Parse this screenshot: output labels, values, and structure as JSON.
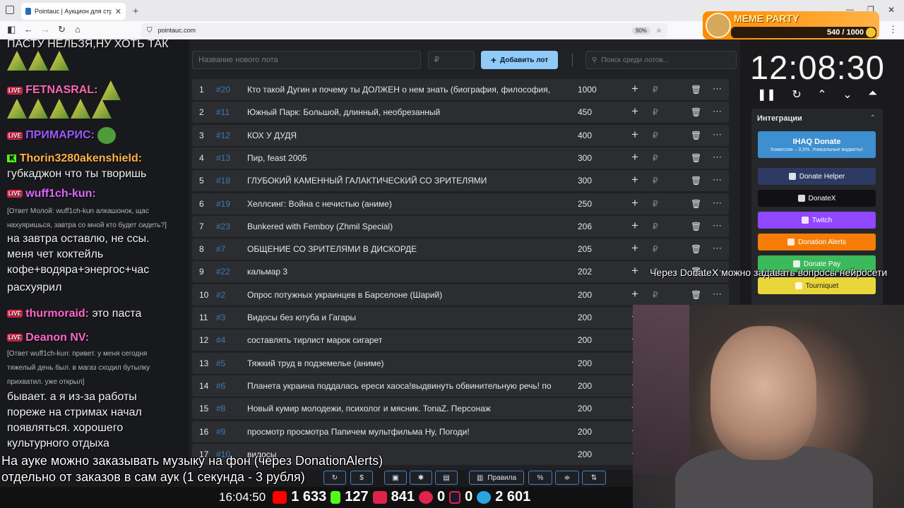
{
  "browser": {
    "tab_title": "Pointauc | Аукцион для стримера",
    "url": "pointauc.com",
    "zoom": "90%"
  },
  "chat": {
    "lines": [
      {
        "text": "ПАСТУ НЕЛЬЗЯ,НУ ХОТЬ ТАК"
      },
      {
        "nick": "FETNASRAL:",
        "nick_color": "#ff69b4"
      },
      {
        "nick": "ПРИМАРИС:",
        "nick_color": "#9b59ff"
      },
      {
        "nick": "Thorin3280akenshield:",
        "nick_color": "#ffb347",
        "text": "губкаджон что ты творишь"
      },
      {
        "nick": "wuff1ch-kun:",
        "nick_color": "#e066ff"
      },
      {
        "reply": "[Ответ Молой: wuff1ch-kun алкашонок, щас нахуяришься, завтра со мной кто будет сидеть?]"
      },
      {
        "text": "на завтра оставлю, не ссы. меня чет коктейль кофе+водяра+энергос+час расхуярил"
      },
      {
        "nick": "thurmoraid:",
        "nick_color": "#ff66cc",
        "text": "это паста"
      },
      {
        "nick": "Deanon NV:",
        "nick_color": "#ff66cc"
      },
      {
        "reply": "[Ответ wuff1ch-kun: привет. у меня сегодня тяжелый день был. в магаз сходил бутылку прихватил. уже открыл]"
      },
      {
        "text": "бывает. а я из-за работы пореже на стримах начал появляться. хорошего культурного отдыха"
      }
    ],
    "line_texts": {
      "l1": "ПАСТУ НЕЛЬЗЯ,НУ ХОТЬ ТАК",
      "l4b": "губкаджон что ты творишь",
      "l6a": "[Ответ Молой: wuff1ch-kun алкашонок, щас",
      "l6b": "нахуяришься, завтра со мной кто будет сидеть?]",
      "l7a": "на завтра оставлю, не ссы.",
      "l7b": "меня чет коктейль",
      "l7c": "кофе+водяра+энергос+час",
      "l7d": "расхуярил",
      "l8": "это паста",
      "l10a": "[Ответ wuff1ch-kun: привет. у меня сегодня",
      "l10b": "тяжелый день был. в магаз сходил бутылку",
      "l10c": "прихватил. уже открыл]",
      "l11a": "бывает. а я из-за работы",
      "l11b": "пореже на стримах начал",
      "l11c": "появляться. хорошего",
      "l11d": "культурного отдыха"
    }
  },
  "lot_form": {
    "name_placeholder": "Название нового лота",
    "price_placeholder": "₽",
    "add_label": "Добавить лот",
    "search_placeholder": "Поиск среди лотов..."
  },
  "lots": [
    {
      "n": "1",
      "id": "#20",
      "name": "Кто такой Дугин и почему ты ДОЛЖЕН о нем знать (биография, философия,",
      "amount": "1000"
    },
    {
      "n": "2",
      "id": "#11",
      "name": "Южный Парк: Большой, длинный, необрезанный",
      "amount": "450"
    },
    {
      "n": "3",
      "id": "#12",
      "name": "КОХ У ДУДЯ",
      "amount": "400"
    },
    {
      "n": "4",
      "id": "#13",
      "name": "Пир, feast 2005",
      "amount": "300"
    },
    {
      "n": "5",
      "id": "#18",
      "name": "ГЛУБОКИЙ КАМЕННЫЙ ГАЛАКТИЧЕСКИЙ СО ЗРИТЕЛЯМИ",
      "amount": "300"
    },
    {
      "n": "6",
      "id": "#19",
      "name": "Хеллсинг: Война с нечистью (аниме)",
      "amount": "250"
    },
    {
      "n": "7",
      "id": "#23",
      "name": "Bunkered with Femboy (Zhmil Special)",
      "amount": "206"
    },
    {
      "n": "8",
      "id": "#7",
      "name": "ОБЩЕНИЕ СО ЗРИТЕЛЯМИ В ДИСКОРДЕ",
      "amount": "205"
    },
    {
      "n": "9",
      "id": "#22",
      "name": "кальмар 3",
      "amount": "202"
    },
    {
      "n": "10",
      "id": "#2",
      "name": "Опрос потужных украинцев в Барселоне (Шарий)",
      "amount": "200"
    },
    {
      "n": "11",
      "id": "#3",
      "name": "Видосы без ютуба и Гагары",
      "amount": "200"
    },
    {
      "n": "12",
      "id": "#4",
      "name": "составлять тирлист марок сигарет",
      "amount": "200"
    },
    {
      "n": "13",
      "id": "#5",
      "name": "Тяжкий труд в подземелье (аниме)",
      "amount": "200"
    },
    {
      "n": "14",
      "id": "#6",
      "name": "Планета украина поддалась ереси хаоса!выдвинуть обвинительную речь! по",
      "amount": "200"
    },
    {
      "n": "15",
      "id": "#8",
      "name": "Новый кумир молодежи, психолог и мясник. TonaZ. Персонаж",
      "amount": "200"
    },
    {
      "n": "16",
      "id": "#9",
      "name": "просмотр просмотра Папичем мультфильма Ну, Погоди!",
      "amount": "200"
    },
    {
      "n": "17",
      "id": "#10",
      "name": "видосы",
      "amount": "200"
    }
  ],
  "lot_currency": "₽",
  "meme_party": {
    "title": "MEME PARTY",
    "count": "540 / 1000"
  },
  "timer": {
    "value": "12:08:30"
  },
  "integrations": {
    "header": "Интеграции",
    "ihaq_title": "IHAQ Donate",
    "ihaq_subtitle": "Комиссия – 3,5%. Уникальные виджеты!",
    "buttons": [
      {
        "label": "Donate Helper",
        "color": "#2d3a63"
      },
      {
        "label": "DonateX",
        "color": "#111114"
      },
      {
        "label": "Twitch",
        "color": "#9146ff"
      },
      {
        "label": "Donation Alerts",
        "color": "#f57d07"
      },
      {
        "label": "Donate Pay",
        "color": "#3cb95a"
      },
      {
        "label": "Tourniquet",
        "color": "#e9d63a"
      }
    ]
  },
  "subtitles": {
    "right": "Через DonateX можно задавать вопросы нейросети",
    "bottom1": "На ауке можно заказывать музыку на фон (через DonationAlerts)",
    "bottom2": "отдельно от заказов в сам аук (1 секунда - 3 рубля)"
  },
  "toolbar": {
    "rules_label": "Правила",
    "percent_label": "%",
    "dollar_label": "$"
  },
  "stats": {
    "clock": "16:04:50",
    "youtube": "1 633",
    "kick": "127",
    "vklive": "841",
    "vkvideo": "0",
    "rutube": "0",
    "telegram": "2 601"
  }
}
